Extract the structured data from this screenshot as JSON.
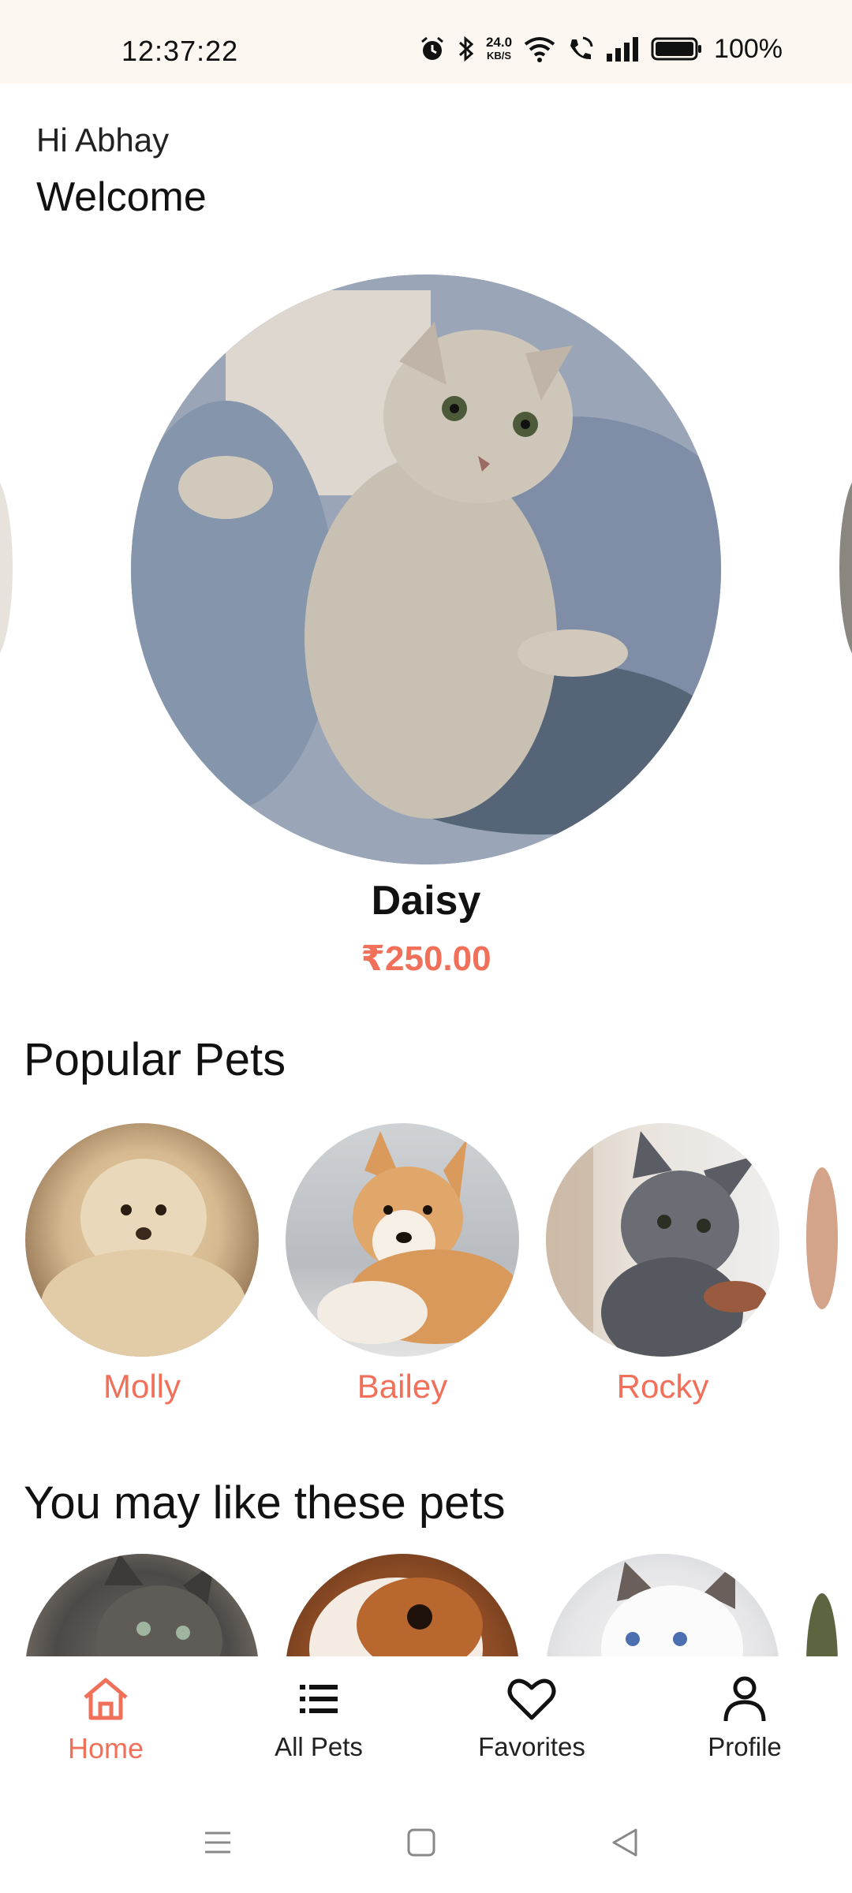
{
  "status_bar": {
    "time": "12:37:22",
    "net_speed_value": "24.0",
    "net_speed_unit": "KB/S",
    "battery": "100%",
    "icons": [
      "alarm-icon",
      "bluetooth-icon",
      "wifi-icon",
      "wifi-call-icon",
      "signal-icon",
      "battery-icon"
    ]
  },
  "header": {
    "greeting": "Hi Abhay",
    "welcome": "Welcome"
  },
  "featured": {
    "name": "Daisy",
    "price": "₹250.00"
  },
  "popular": {
    "title": "Popular Pets",
    "pets": [
      {
        "name": "Molly"
      },
      {
        "name": "Bailey"
      },
      {
        "name": "Rocky"
      }
    ]
  },
  "recommended": {
    "title": "You may like these pets"
  },
  "bottom_nav": {
    "items": [
      {
        "label": "Home",
        "icon": "home-icon",
        "active": true
      },
      {
        "label": "All Pets",
        "icon": "list-icon",
        "active": false
      },
      {
        "label": "Favorites",
        "icon": "heart-icon",
        "active": false
      },
      {
        "label": "Profile",
        "icon": "person-icon",
        "active": false
      }
    ]
  },
  "colors": {
    "accent": "#f0705a",
    "status_bar_bg": "#fdf7f2"
  }
}
